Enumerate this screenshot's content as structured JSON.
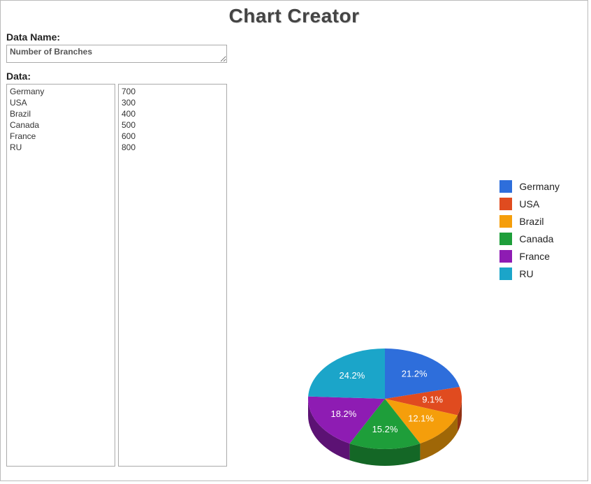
{
  "title": "Chart Creator",
  "labels": {
    "data_name": "Data Name:",
    "data": "Data:"
  },
  "inputs": {
    "data_name_value": "Number of Branches",
    "categories_text": "Germany\nUSA\nBrazil\nCanada\nFrance\nRU",
    "values_text": "700\n300\n400\n500\n600\n800"
  },
  "chart_data": {
    "type": "pie",
    "title": "",
    "series": [
      {
        "name": "Germany",
        "value": 700,
        "percent": 21.2,
        "color": "#2E6EDB"
      },
      {
        "name": "USA",
        "value": 300,
        "percent": 9.1,
        "color": "#E04B1F"
      },
      {
        "name": "Brazil",
        "value": 400,
        "percent": 12.1,
        "color": "#F59E0B"
      },
      {
        "name": "Canada",
        "value": 500,
        "percent": 15.2,
        "color": "#1E9E3A"
      },
      {
        "name": "France",
        "value": 600,
        "percent": 18.2,
        "color": "#8E1CB3"
      },
      {
        "name": "RU",
        "value": 800,
        "percent": 24.2,
        "color": "#1BA5C9"
      }
    ]
  }
}
